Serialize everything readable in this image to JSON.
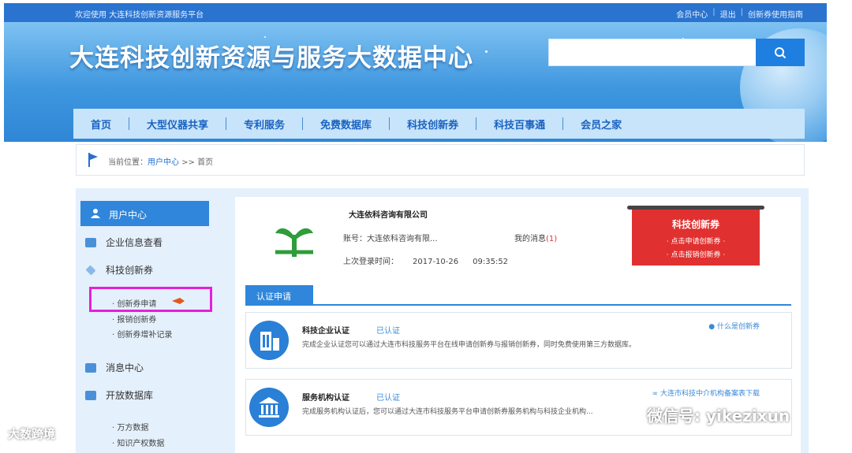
{
  "top_bar": {
    "welcome": "欢迎使用 大连科技创新资源服务平台",
    "links": [
      "会员中心",
      "退出",
      "创新券使用指南"
    ]
  },
  "header": {
    "title": "大连科技创新资源与服务大数据中心",
    "search": {
      "value": "",
      "placeholder": ""
    }
  },
  "nav": {
    "items": [
      "首页",
      "大型仪器共享",
      "专利服务",
      "免费数据库",
      "科技创新券",
      "科技百事通",
      "会员之家"
    ]
  },
  "breadcrumb": {
    "prefix": "当前位置：",
    "link": "用户中心",
    "rest": " >> 首页"
  },
  "sidebar": {
    "head": "用户中心",
    "items": [
      {
        "label": "企业信息查看",
        "icon": "document-icon"
      },
      {
        "label": "科技创新券",
        "icon": "diamond-icon"
      },
      {
        "label": "消息中心",
        "icon": "message-icon"
      },
      {
        "label": "开放数据库",
        "icon": "database-icon"
      }
    ],
    "voucher_subitems": [
      "· 创新券申请",
      "· 报销创新券",
      "· 创新券增补记录"
    ],
    "db_subitems": [
      "· 万方数据",
      "· 知识产权数据"
    ]
  },
  "profile": {
    "company": "大连依科咨询有限公司",
    "account": "账号：大连依科咨询有限...",
    "message_label": "我的消息",
    "message_count": "(1)",
    "last_login_label": "上次登录时间：",
    "last_login_date": "2017-10-26",
    "last_login_time": "09:35:52"
  },
  "promo": {
    "title": "科技创新券",
    "link1": "· 点击申请创新券 ·",
    "link2": "· 点击报销创新券 ·"
  },
  "tab": {
    "label": "认证申请"
  },
  "cards": [
    {
      "title": "科技企业认证",
      "status": "已认证",
      "desc": "完成企业认证您可以通过大连市科技服务平台在线申请创新券与报销创新券，同时免费使用第三方数据库。",
      "right_link": "什么是创新券",
      "icon": "building-icon"
    },
    {
      "title": "服务机构认证",
      "status": "已认证",
      "desc": "完成服务机构认证后，您可以通过大连市科技服务平台申请创新券服务机构与科技企业机构...",
      "right_link": "大连市科技中介机构备案表下载",
      "icon": "institution-icon"
    }
  ],
  "watermarks": {
    "left": "大数跨境",
    "right": "微信号: yikezixun"
  },
  "colors": {
    "brand_blue": "#2f86da",
    "promo_red": "#e03030",
    "highlight_magenta": "#e520d8"
  }
}
